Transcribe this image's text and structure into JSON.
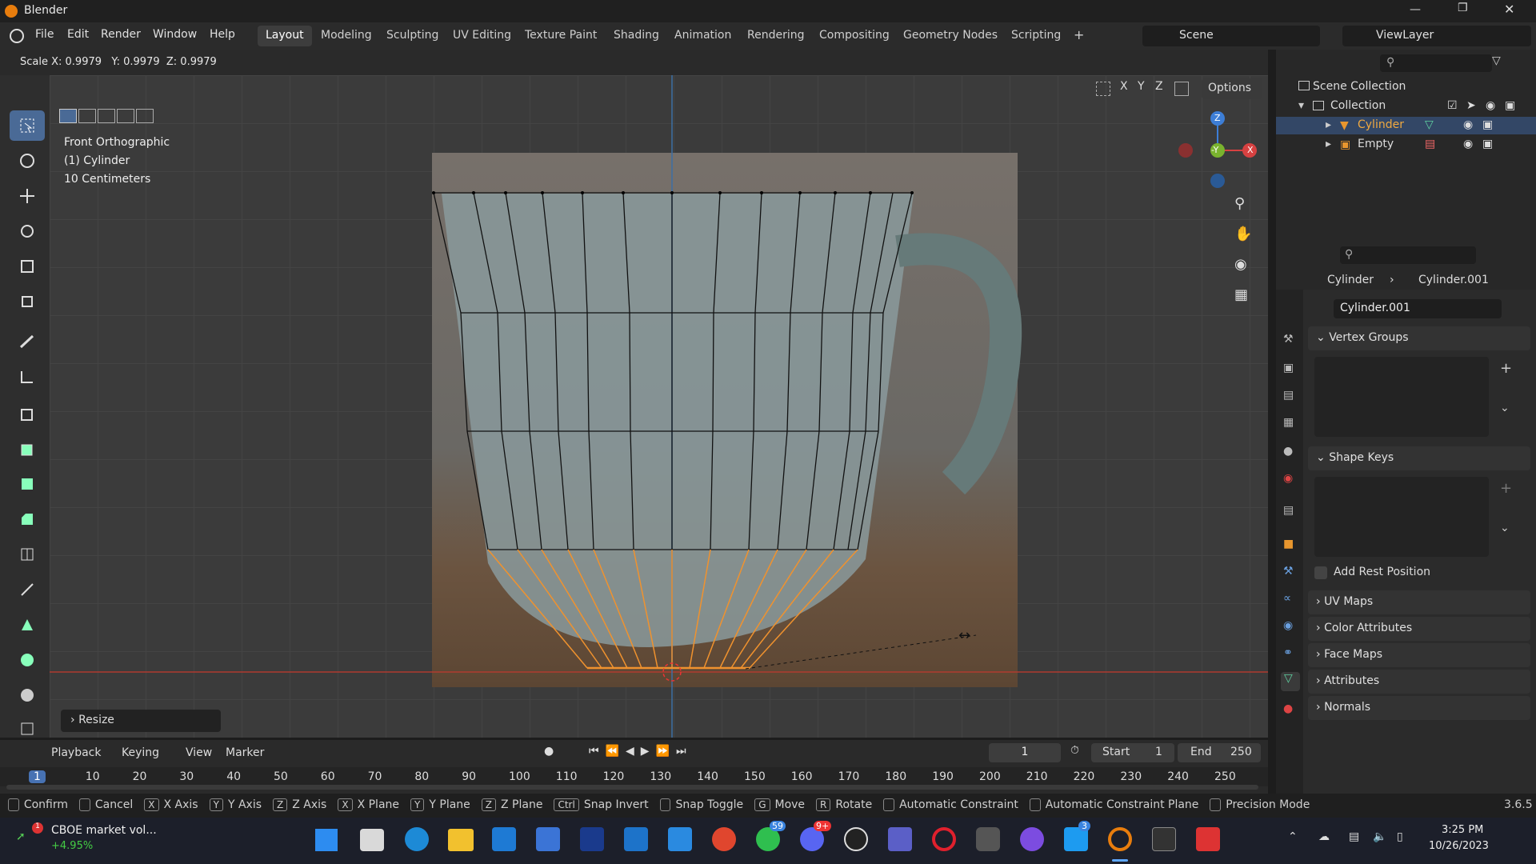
{
  "app": {
    "title": "Blender"
  },
  "menu": {
    "items": [
      "File",
      "Edit",
      "Render",
      "Window",
      "Help"
    ]
  },
  "workspaces": {
    "tabs": [
      "Layout",
      "Modeling",
      "Sculpting",
      "UV Editing",
      "Texture Paint",
      "Shading",
      "Animation",
      "Rendering",
      "Compositing",
      "Geometry Nodes",
      "Scripting"
    ],
    "active": "Layout",
    "add": "+"
  },
  "scene": {
    "name": "Scene",
    "viewlayer": "ViewLayer"
  },
  "header": {
    "scale_readout": "Scale X: 0.9979   Y: 0.9979  Z: 0.9979",
    "axes": [
      "X",
      "Y",
      "Z"
    ],
    "options": "Options"
  },
  "viewport": {
    "view_name": "Front Orthographic",
    "object": "(1) Cylinder",
    "scale": "10 Centimeters",
    "resize_panel": "Resize",
    "gizmo": {
      "z": "Z",
      "y": "-Y",
      "x": "X"
    }
  },
  "outliner": {
    "scene_collection": "Scene Collection",
    "collection": "Collection",
    "items": [
      {
        "name": "Cylinder"
      },
      {
        "name": "Empty"
      }
    ]
  },
  "properties": {
    "breadcrumb_object": "Cylinder",
    "breadcrumb_data": "Cylinder.001",
    "data_name": "Cylinder.001",
    "panels": {
      "vertex_groups": "Vertex Groups",
      "shape_keys": "Shape Keys",
      "add_rest": "Add Rest Position",
      "uv_maps": "UV Maps",
      "color_attributes": "Color Attributes",
      "face_maps": "Face Maps",
      "attributes": "Attributes",
      "normals": "Normals"
    }
  },
  "timeline": {
    "menus": [
      "Playback",
      "Keying",
      "View",
      "Marker"
    ],
    "current_frame": "1",
    "start_label": "Start",
    "start": "1",
    "end_label": "End",
    "end": "250",
    "ruler": [
      "1",
      "10",
      "20",
      "30",
      "40",
      "50",
      "60",
      "70",
      "80",
      "90",
      "100",
      "110",
      "120",
      "130",
      "140",
      "150",
      "160",
      "170",
      "180",
      "190",
      "200",
      "210",
      "220",
      "230",
      "240",
      "250"
    ]
  },
  "status": {
    "items": [
      "Confirm",
      "Cancel",
      "X Axis",
      "Y Axis",
      "Z Axis",
      "X Plane",
      "Y Plane",
      "Z Plane",
      "Snap Invert",
      "Snap Toggle",
      "Move",
      "Rotate",
      "Automatic Constraint",
      "Automatic Constraint Plane",
      "Precision Mode"
    ],
    "keys": [
      "",
      "",
      "X",
      "Y",
      "Z",
      "X",
      "Y",
      "Z",
      "Ctrl",
      "",
      "G",
      "R",
      "",
      "",
      ""
    ],
    "version": "3.6.5"
  },
  "taskbar": {
    "stock_name": "CBOE market vol...",
    "stock_change": "+4.95%",
    "time": "3:25 PM",
    "date": "10/26/2023",
    "badges": {
      "whatsapp": "59",
      "discord": "9+",
      "twitter": "3"
    }
  }
}
